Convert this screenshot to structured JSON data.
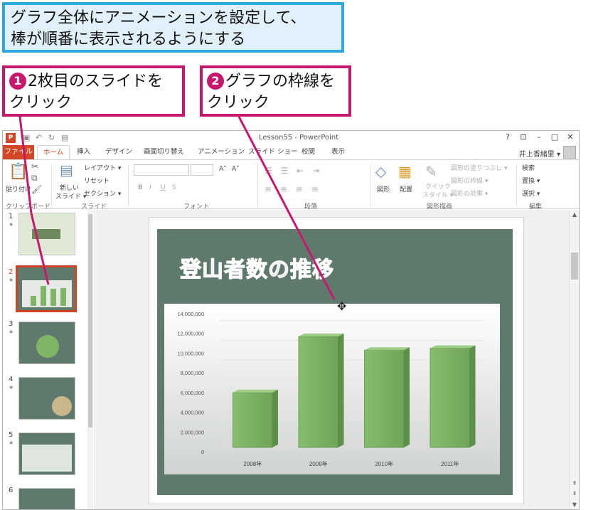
{
  "callout_top": {
    "line1": "グラフ全体にアニメーションを設定して、",
    "line2": "棒が順番に表示されるようにする"
  },
  "callout_1": {
    "num": "1",
    "line1": "2枚目のスライドを",
    "line2": "クリック"
  },
  "callout_2": {
    "num": "2",
    "line1": "グラフの枠線を",
    "line2": "クリック"
  },
  "window": {
    "title": "Lesson55 - PowerPoint",
    "controls": {
      "help": "?",
      "restore_ribbon": "⊡",
      "minimize": "–",
      "maximize": "□",
      "close": "✕"
    },
    "user_name": "井上香緒里 ▾"
  },
  "tabs": [
    "ファイル",
    "ホーム",
    "挿入",
    "デザイン",
    "画面切り替え",
    "アニメーション",
    "スライド ショー",
    "校閲",
    "表示"
  ],
  "ribbon": {
    "paste": "貼り付け",
    "clipboard_group": "クリップボード",
    "new_slide": "新しい",
    "new_slide2": "スライド ▾",
    "layout": "レイアウト ▾",
    "reset": "リセット",
    "section": "セクション ▾",
    "slides_group": "スライド",
    "font_group": "フォント",
    "paragraph_group": "段落",
    "shape": "図形",
    "arrange": "配置",
    "quick_style": "クイック",
    "quick_style2": "スタイル ▾",
    "shape_fill": "図形の塗りつぶし ▾",
    "shape_outline": "図形の枠線 ▾",
    "shape_effects": "図形の効果 ▾",
    "drawing_group": "図形描画",
    "find": "検索",
    "replace": "置換 ▾",
    "select": "選択 ▾",
    "editing_group": "編集",
    "font_size_up": "A˄",
    "font_size_down": "A˅",
    "bold": "B",
    "italic": "I",
    "underline": "U",
    "strike": "S"
  },
  "slides_panel": [
    {
      "num": "1",
      "star": "★"
    },
    {
      "num": "2",
      "star": "★"
    },
    {
      "num": "3",
      "star": "★"
    },
    {
      "num": "4",
      "star": "★"
    },
    {
      "num": "5",
      "star": "★"
    },
    {
      "num": "6",
      "star": ""
    }
  ],
  "slide": {
    "title": "登山者数の推移"
  },
  "colors": {
    "accent": "#d24726",
    "callout_border": "#c8186e",
    "callout_top_border": "#2ea7e0",
    "slide_bg": "#5f7a6c",
    "bar": "#7fb567"
  },
  "chart_data": {
    "type": "bar",
    "categories": [
      "2008年",
      "2009年",
      "2010年",
      "2011年"
    ],
    "values": [
      6000000,
      11700000,
      10300000,
      10500000
    ],
    "y_tick_labels": [
      "0",
      "2,000,000",
      "4,000,000",
      "6,000,000",
      "8,000,000",
      "10,000,000",
      "12,000,000",
      "14,000,000"
    ],
    "ylim": [
      0,
      14000000
    ],
    "grid": true,
    "title": ""
  }
}
